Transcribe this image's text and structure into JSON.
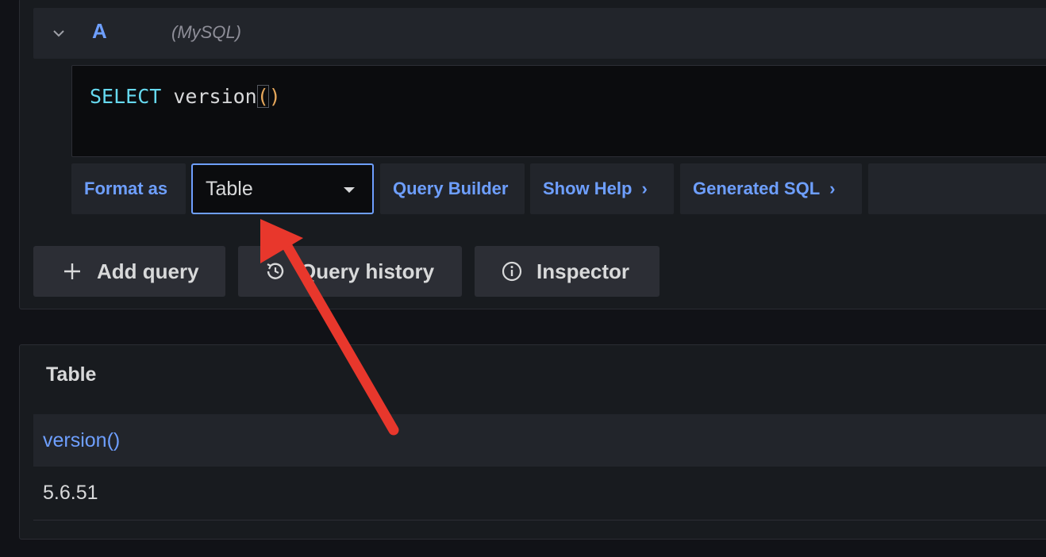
{
  "query": {
    "letter": "A",
    "datasource": "(MySQL)",
    "sql": {
      "keyword": "SELECT",
      "function": " version",
      "open_paren": "(",
      "close_paren": ")"
    },
    "options": {
      "format_label": "Format as",
      "format_value": "Table",
      "query_builder": "Query Builder",
      "show_help": "Show Help",
      "generated_sql": "Generated SQL"
    }
  },
  "actions": {
    "add_query": "Add query",
    "query_history": "Query history",
    "inspector": "Inspector"
  },
  "results": {
    "title": "Table",
    "columns": [
      "version()"
    ],
    "rows": [
      [
        "5.6.51"
      ]
    ]
  },
  "icons": {
    "collapse": "chevron-down-icon",
    "caret": "caret-down-icon",
    "add": "plus-icon",
    "history": "history-icon",
    "inspector": "info-circle-icon",
    "chevron": "chevron-right-icon"
  },
  "colors": {
    "accent": "#6e9fff",
    "annotation": "#e8372c",
    "keyword": "#66d9ef",
    "paren": "#e5a75b"
  }
}
